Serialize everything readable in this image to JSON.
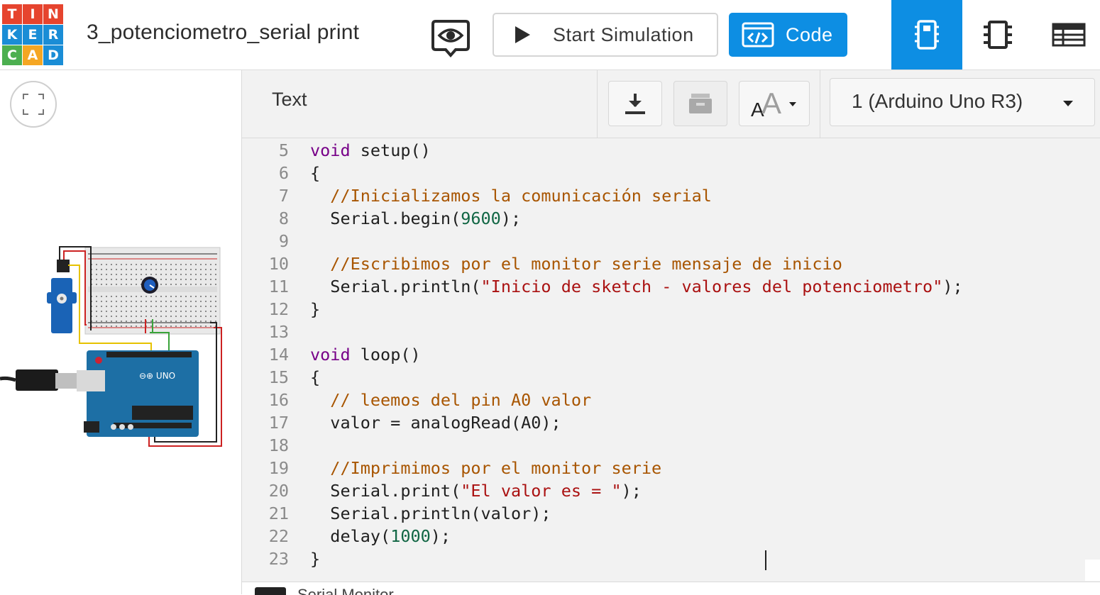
{
  "app": {
    "logo_letters": [
      "T",
      "I",
      "N",
      "K",
      "E",
      "R",
      "C",
      "A",
      "D"
    ],
    "logo_colors": [
      "#e6442e",
      "#e6442e",
      "#e6442e",
      "#1a8dd6",
      "#1a8dd6",
      "#1a8dd6",
      "#4caf50",
      "#f5a623",
      "#1a8dd6"
    ],
    "project_title": "3_potenciometro_serial print",
    "accent_color": "#0d8ee3"
  },
  "toolbar": {
    "share_icon": "eye-icon",
    "start_simulation_label": "Start Simulation",
    "code_label": "Code",
    "view_tabs": [
      {
        "icon": "circuit-view-icon",
        "active": true
      },
      {
        "icon": "component-list-icon",
        "active": false
      },
      {
        "icon": "table-view-icon",
        "active": false
      }
    ]
  },
  "code_panel": {
    "mode_label": "Text",
    "download_icon": "download-icon",
    "library_icon": "library-icon",
    "font_size_icon": "font-size-icon",
    "board_select": "1 (Arduino Uno R3)"
  },
  "code_lines": [
    {
      "n": "5",
      "parts": [
        [
          "kw",
          "void"
        ],
        [
          "",
          "setup()"
        ]
      ]
    },
    {
      "n": "6",
      "parts": [
        [
          "",
          "{"
        ]
      ]
    },
    {
      "n": "7",
      "parts": [
        [
          "",
          "  "
        ],
        [
          "cm",
          "//Inicializamos la comunicación serial"
        ]
      ]
    },
    {
      "n": "8",
      "parts": [
        [
          "",
          "  Serial.begin("
        ],
        [
          "num",
          "9600"
        ],
        [
          "",
          ");"
        ]
      ]
    },
    {
      "n": "9",
      "parts": []
    },
    {
      "n": "10",
      "parts": [
        [
          "",
          "  "
        ],
        [
          "cm",
          "//Escribimos por el monitor serie mensaje de inicio"
        ]
      ]
    },
    {
      "n": "11",
      "parts": [
        [
          "",
          "  Serial.println("
        ],
        [
          "str",
          "\"Inicio de sketch - valores del potenciometro\""
        ],
        [
          "",
          ");"
        ]
      ]
    },
    {
      "n": "12",
      "parts": [
        [
          "",
          "}"
        ]
      ]
    },
    {
      "n": "13",
      "parts": []
    },
    {
      "n": "14",
      "parts": [
        [
          "kw",
          "void"
        ],
        [
          "",
          "loop()"
        ]
      ]
    },
    {
      "n": "15",
      "parts": [
        [
          "",
          "{"
        ]
      ]
    },
    {
      "n": "16",
      "parts": [
        [
          "",
          "  "
        ],
        [
          "cm",
          "// leemos del pin A0 valor"
        ]
      ]
    },
    {
      "n": "17",
      "parts": [
        [
          "",
          "  valor = analogRead(A0);"
        ]
      ]
    },
    {
      "n": "18",
      "parts": []
    },
    {
      "n": "19",
      "parts": [
        [
          "",
          "  "
        ],
        [
          "cm",
          "//Imprimimos por el monitor serie"
        ]
      ]
    },
    {
      "n": "20",
      "parts": [
        [
          "",
          "  Serial.print("
        ],
        [
          "str",
          "\"El valor es = \""
        ],
        [
          "",
          ");"
        ]
      ]
    },
    {
      "n": "21",
      "parts": [
        [
          "",
          "  Serial.println(valor);"
        ]
      ]
    },
    {
      "n": "22",
      "parts": [
        [
          "",
          "  delay("
        ],
        [
          "num",
          "1000"
        ],
        [
          "",
          ");"
        ]
      ]
    },
    {
      "n": "23",
      "parts": [
        [
          "",
          "}"
        ]
      ]
    }
  ],
  "serial_monitor_label": "Serial Monitor"
}
